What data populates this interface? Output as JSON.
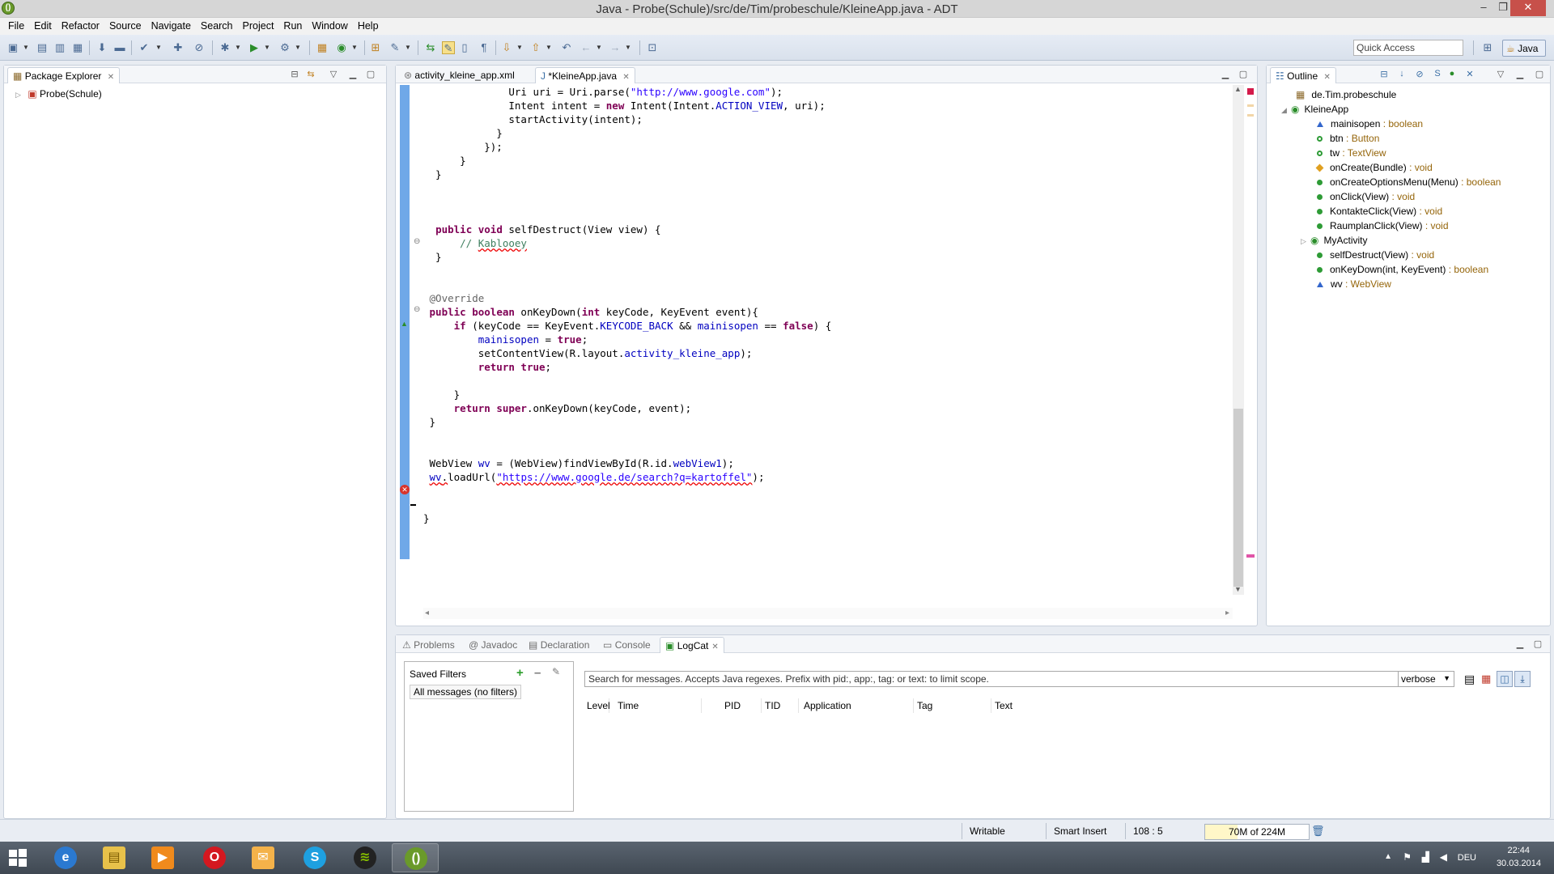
{
  "window": {
    "title": "Java - Probe(Schule)/src/de/Tim/probeschule/KleineApp.java - ADT",
    "minimize": "–",
    "maximize": "❐",
    "close": "✕"
  },
  "menu": [
    "File",
    "Edit",
    "Refactor",
    "Source",
    "Navigate",
    "Search",
    "Project",
    "Run",
    "Window",
    "Help"
  ],
  "toolbar": {
    "quick_access_placeholder": "Quick Access",
    "perspective_label": "Java"
  },
  "package_explorer": {
    "tab_label": "Package Explorer",
    "project": "Probe(Schule)"
  },
  "editor": {
    "tabs": [
      {
        "label": "activity_kleine_app.xml",
        "active": false
      },
      {
        "label": "*KleineApp.java",
        "active": true
      }
    ],
    "lines": [
      "              Uri uri = Uri.parse(\"http://www.google.com\");",
      "              Intent intent = new Intent(Intent.ACTION_VIEW, uri);",
      "              startActivity(intent);",
      "            }",
      "          });",
      "      }",
      "  }",
      "",
      "",
      "",
      "  public void selfDestruct(View view) {",
      "      // Kablooey",
      "  }",
      "",
      "",
      " @Override",
      " public boolean onKeyDown(int keyCode, KeyEvent event){",
      "     if (keyCode == KeyEvent.KEYCODE_BACK && mainisopen == false) {",
      "         mainisopen = true;",
      "         setContentView(R.layout.activity_kleine_app);",
      "         return true;",
      "",
      "     }",
      "     return super.onKeyDown(keyCode, event);",
      " }",
      "",
      "",
      " WebView wv = (WebView)findViewById(R.id.webView1);",
      " wv.loadUrl(\"https://www.google.de/search?q=kartoffel\");",
      "",
      "",
      "}"
    ]
  },
  "outline": {
    "tab_label": "Outline",
    "package": "de.Tim.probeschule",
    "class": "KleineApp",
    "members": [
      {
        "name": "mainisopen",
        "type": " : boolean",
        "icon": "field-default-icon"
      },
      {
        "name": "btn",
        "type": " : Button",
        "icon": "field-private-icon"
      },
      {
        "name": "tw",
        "type": " : TextView",
        "icon": "field-private-icon"
      },
      {
        "name": "onCreate(Bundle)",
        "type": " : void",
        "icon": "method-protected-icon"
      },
      {
        "name": "onCreateOptionsMenu(Menu)",
        "type": " : boolean",
        "icon": "method-public-icon"
      },
      {
        "name": "onClick(View)",
        "type": " : void",
        "icon": "method-public-icon"
      },
      {
        "name": "KontakteClick(View)",
        "type": " : void",
        "icon": "method-public-icon"
      },
      {
        "name": "RaumplanClick(View)",
        "type": " : void",
        "icon": "method-public-icon"
      },
      {
        "name": "MyActivity",
        "type": "",
        "icon": "class-icon"
      },
      {
        "name": "selfDestruct(View)",
        "type": " : void",
        "icon": "method-public-icon"
      },
      {
        "name": "onKeyDown(int, KeyEvent)",
        "type": " : boolean",
        "icon": "method-public-icon"
      },
      {
        "name": "wv",
        "type": " : WebView",
        "icon": "field-default-icon"
      }
    ]
  },
  "bottom_panel": {
    "tabs": [
      "Problems",
      "Javadoc",
      "Declaration",
      "Console",
      "LogCat"
    ],
    "active_tab": "LogCat",
    "saved_filters_label": "Saved Filters",
    "filter_item": "All messages (no filters)",
    "search_placeholder": "Search for messages. Accepts Java regexes. Prefix with pid:, app:, tag: or text: to limit scope.",
    "level_select": "verbose",
    "columns": [
      "Level",
      "Time",
      "PID",
      "TID",
      "Application",
      "Tag",
      "Text"
    ]
  },
  "status": {
    "writable": "Writable",
    "insert_mode": "Smart Insert",
    "position": "108 : 5",
    "heap": "70M of 224M",
    "heap_fraction": 0.31
  },
  "taskbar": {
    "apps": [
      {
        "name": "internet-explorer-icon",
        "open": false
      },
      {
        "name": "file-explorer-icon",
        "open": false
      },
      {
        "name": "media-player-icon",
        "open": false
      },
      {
        "name": "opera-icon",
        "open": false
      },
      {
        "name": "mail-icon",
        "open": false
      },
      {
        "name": "skype-icon",
        "open": false
      },
      {
        "name": "spotify-icon",
        "open": false
      },
      {
        "name": "adt-icon",
        "open": true
      }
    ],
    "language": "DEU",
    "time": "22:44",
    "date": "30.03.2014"
  }
}
